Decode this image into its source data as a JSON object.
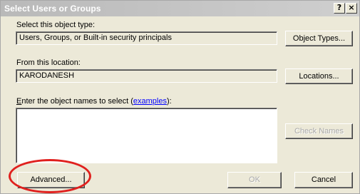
{
  "window": {
    "title": "Select Users or Groups",
    "help_glyph": "?",
    "close_glyph": "×"
  },
  "object_type": {
    "label": "Select this object type:",
    "value": "Users, Groups, or Built-in security principals",
    "button": "Object Types..."
  },
  "location": {
    "label": "From this location:",
    "value": "KARODANESH",
    "button": "Locations..."
  },
  "names": {
    "label_prefix": "",
    "label_accel": "E",
    "label_rest": "nter the object names to select (",
    "examples_link": "examples",
    "label_suffix": "):",
    "value": "",
    "check_button": "Check Names"
  },
  "footer": {
    "advanced_button": "Advanced...",
    "ok_button": "OK",
    "cancel_button": "Cancel"
  },
  "annotation": {
    "ring_color": "#e0201e"
  }
}
